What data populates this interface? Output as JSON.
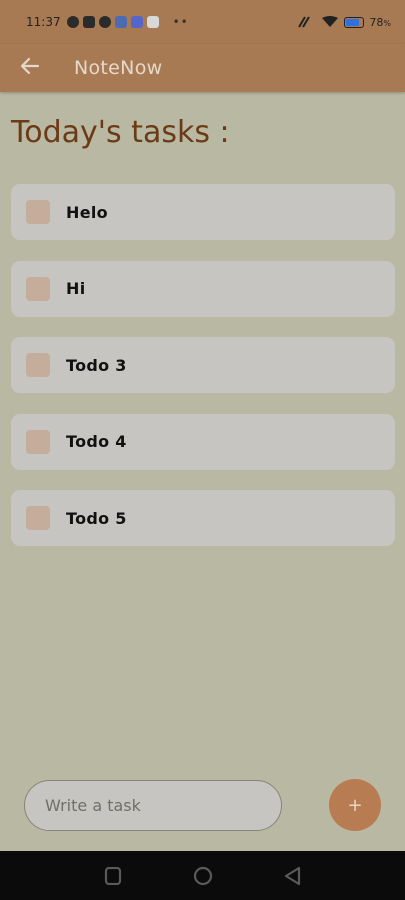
{
  "status_bar": {
    "time": "11:37",
    "battery_percent": "78",
    "battery_unit": "%",
    "battery_level": 0.78,
    "notification_icons": [
      "dnd-icon",
      "tiktok-icon",
      "clock-icon",
      "messenger-icon",
      "discord-icon",
      "app-icon"
    ]
  },
  "app_bar": {
    "title": "NoteNow",
    "back_icon": "arrow-left-icon"
  },
  "main": {
    "heading": "Today's tasks :",
    "tasks": [
      {
        "label": "Helo",
        "checked": false
      },
      {
        "label": "Hi",
        "checked": false
      },
      {
        "label": "Todo 3",
        "checked": false
      },
      {
        "label": "Todo 4",
        "checked": false
      },
      {
        "label": "Todo 5",
        "checked": false
      }
    ]
  },
  "composer": {
    "placeholder": "Write a task",
    "value": "",
    "add_label": "+"
  },
  "colors": {
    "app_bar": "#a87a54",
    "background": "#b9b9a3",
    "heading": "#6b3a17",
    "card": "#c6c5c2",
    "checkbox": "#c4ad9a",
    "fab": "#b87c52"
  }
}
